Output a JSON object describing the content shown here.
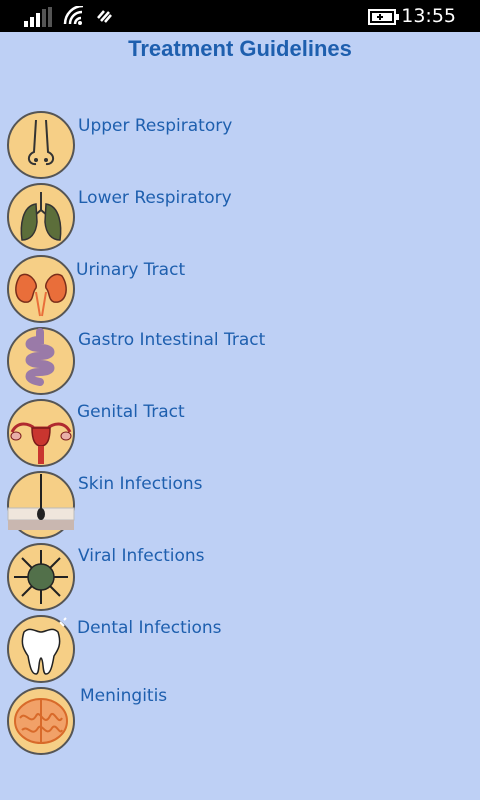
{
  "status_bar": {
    "time": "13:55",
    "icons": [
      "signal-icon",
      "wifi-icon",
      "data-sync-icon",
      "battery-charging-icon"
    ]
  },
  "header": {
    "title": "Treatment Guidelines"
  },
  "items": [
    {
      "label": "Upper Respiratory",
      "icon": "nose-icon"
    },
    {
      "label": "Lower Respiratory",
      "icon": "lungs-icon"
    },
    {
      "label": "Urinary Tract",
      "icon": "kidneys-icon"
    },
    {
      "label": "Gastro Intestinal Tract",
      "icon": "intestine-icon"
    },
    {
      "label": "Genital Tract",
      "icon": "uterus-icon"
    },
    {
      "label": "Skin Infections",
      "icon": "skin-icon"
    },
    {
      "label": "Viral Infections",
      "icon": "virus-icon"
    },
    {
      "label": "Dental Infections",
      "icon": "tooth-icon"
    },
    {
      "label": "Meningitis",
      "icon": "brain-icon"
    }
  ],
  "colors": {
    "background": "#bed0f5",
    "accent": "#1e5fae",
    "icon_fill": "#f6cf86",
    "icon_ring": "#555555"
  }
}
